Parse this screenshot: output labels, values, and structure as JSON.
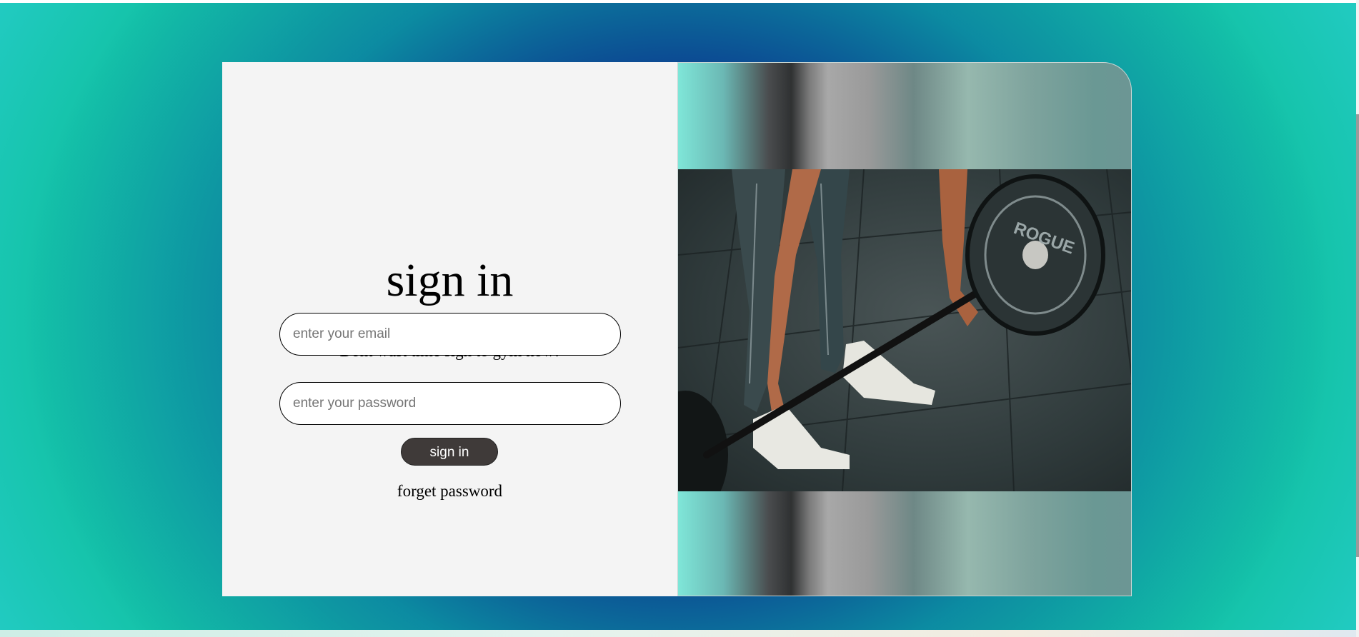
{
  "login": {
    "title": "sign in",
    "subtitle": "Dont wast time sign to gym now!",
    "email_placeholder": "enter your email",
    "password_placeholder": "enter your password",
    "signin_label": "sign in",
    "forget_label": "forget password"
  },
  "photo": {
    "plate_text": "ROGUE"
  },
  "colors": {
    "button_bg": "#3f3a39",
    "panel_bg": "#f4f4f4",
    "background_center": "#081082",
    "background_edge": "#3ddcf2"
  }
}
